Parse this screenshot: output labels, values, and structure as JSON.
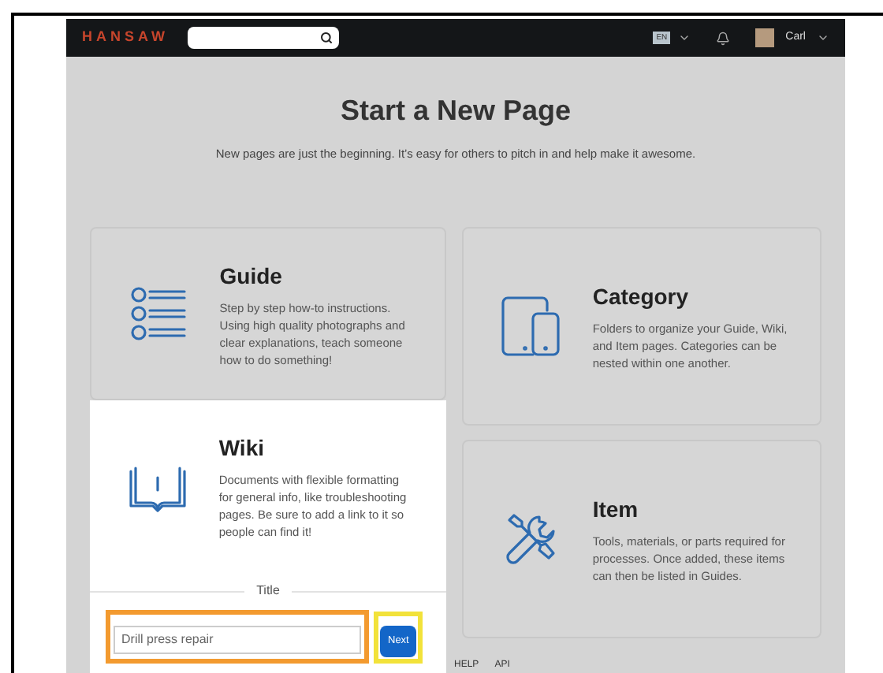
{
  "header": {
    "logo": "HANSAW",
    "language": "EN",
    "user": "Carl"
  },
  "page": {
    "title": "Start a New Page",
    "subtitle": "New pages are just the beginning. It’s easy for others to pitch in and help make it awesome."
  },
  "cards": [
    {
      "kind": "guide",
      "title": "Guide",
      "description": "Step by step how-to instructions. Using high quality photographs and clear explanations, teach someone how to do something!",
      "selected": false
    },
    {
      "kind": "category",
      "title": "Category",
      "description": "Folders to organize your Guide, Wiki, and Item pages. Categories can be nested within one another.",
      "selected": false
    },
    {
      "kind": "wiki",
      "title": "Wiki",
      "description": "Documents with flexible formatting for general info, like troubleshooting pages. Be sure to add a link to it so people can find it!",
      "selected": true,
      "form": {
        "label": "Title",
        "value": "Drill press repair",
        "button": "Next"
      }
    },
    {
      "kind": "item",
      "title": "Item",
      "description": "Tools, materials, or parts required for processes. Once added, these items can then be listed in Guides.",
      "selected": false
    }
  ],
  "footer": {
    "links": [
      "HELP",
      "API"
    ]
  }
}
